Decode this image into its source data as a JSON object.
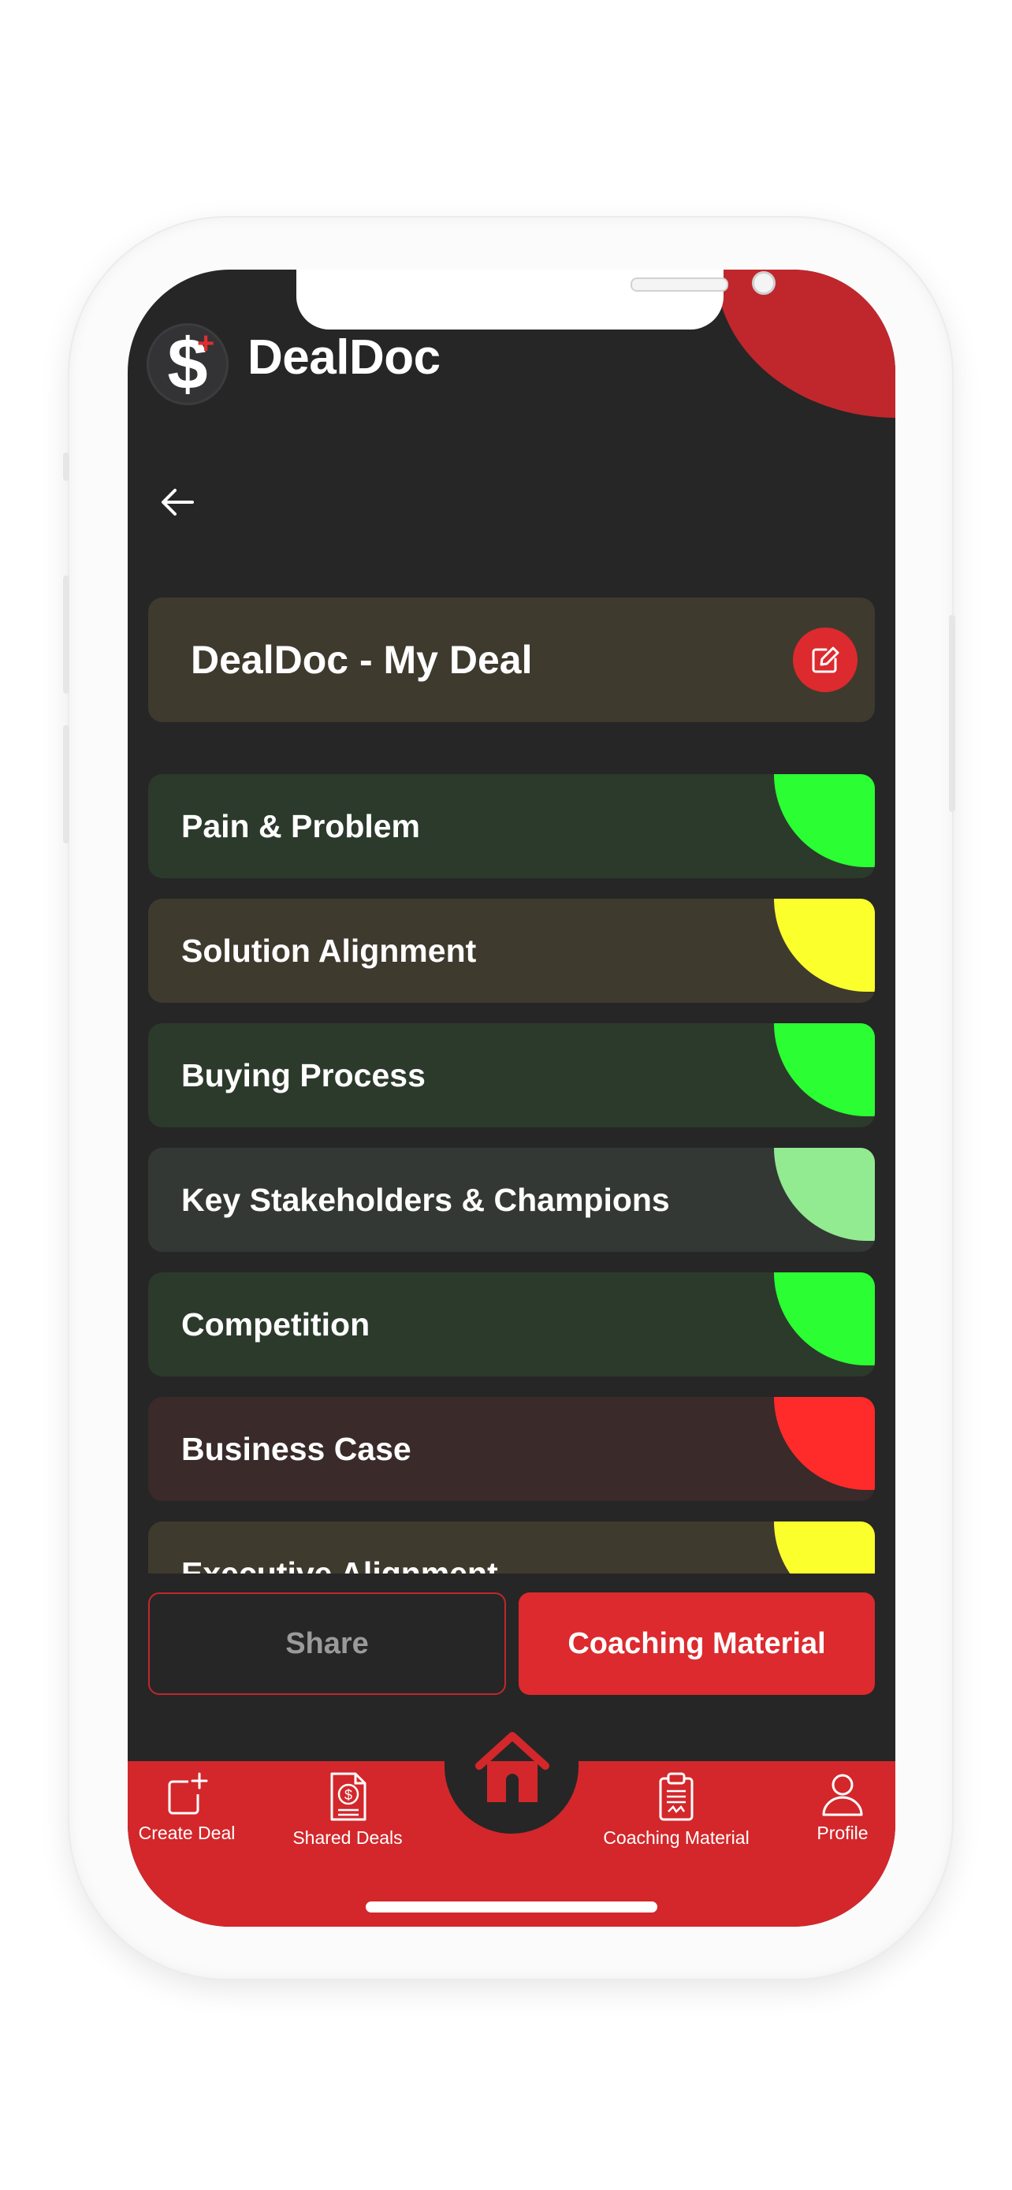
{
  "app": {
    "name": "DealDoc"
  },
  "deal": {
    "title": "DealDoc - My Deal"
  },
  "sections": [
    {
      "label": "Pain & Problem",
      "status_color": "#2bff33",
      "bg": "#2c3a2c"
    },
    {
      "label": "Solution Alignment",
      "status_color": "#fbff2c",
      "bg": "#3f3a2e"
    },
    {
      "label": "Buying Process",
      "status_color": "#2bff33",
      "bg": "#2c3a2c"
    },
    {
      "label": "Key Stakeholders & Champions",
      "status_color": "#92ea91",
      "bg": "#333835"
    },
    {
      "label": "Competition",
      "status_color": "#2bff33",
      "bg": "#2c3a2c"
    },
    {
      "label": "Business Case",
      "status_color": "#ff2b2b",
      "bg": "#3a2a2a"
    },
    {
      "label": "Executive Alignment",
      "status_color": "#fbff2c",
      "bg": "#3f3a2e"
    }
  ],
  "actions": {
    "share": "Share",
    "coaching": "Coaching Material"
  },
  "tabs": [
    {
      "label": "Create Deal",
      "icon": "create-deal-icon"
    },
    {
      "label": "Shared Deals",
      "icon": "shared-deals-icon"
    },
    {
      "label": "Home",
      "icon": "home-icon"
    },
    {
      "label": "Coaching Material",
      "icon": "clipboard-icon"
    },
    {
      "label": "Profile",
      "icon": "profile-icon"
    }
  ],
  "colors": {
    "brand_red": "#dc2a2e",
    "screen_bg": "#262626"
  }
}
